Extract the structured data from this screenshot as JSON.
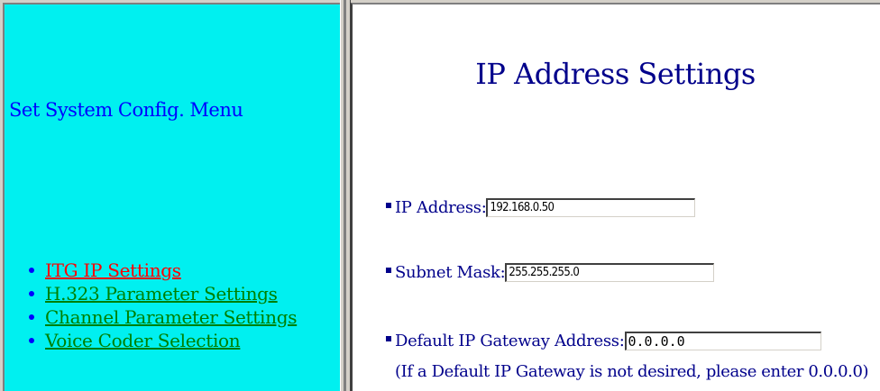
{
  "left_frame": {
    "menu_title": "Set System Config. Menu",
    "items": [
      {
        "label": "ITG IP Settings",
        "active": true
      },
      {
        "label": "H.323 Parameter Settings",
        "active": false
      },
      {
        "label": "Channel Parameter Settings",
        "active": false
      },
      {
        "label": "Voice Coder Selection",
        "active": false
      }
    ],
    "background_color": "#00f0f0",
    "link_color": "#008000",
    "active_link_color": "#ff0000"
  },
  "right_frame": {
    "title": "IP Address Settings",
    "fields": {
      "ip_address": {
        "label": "IP Address:",
        "value": "192.168.0.50"
      },
      "subnet_mask": {
        "label": "Subnet Mask:",
        "value": "255.255.255.0"
      },
      "default_gateway": {
        "label": "Default IP Gateway Address:",
        "value": "0.0.0.0"
      }
    },
    "gateway_note": "(If a Default IP Gateway is not desired, please enter 0.0.0.0)",
    "text_color": "#00008b"
  }
}
